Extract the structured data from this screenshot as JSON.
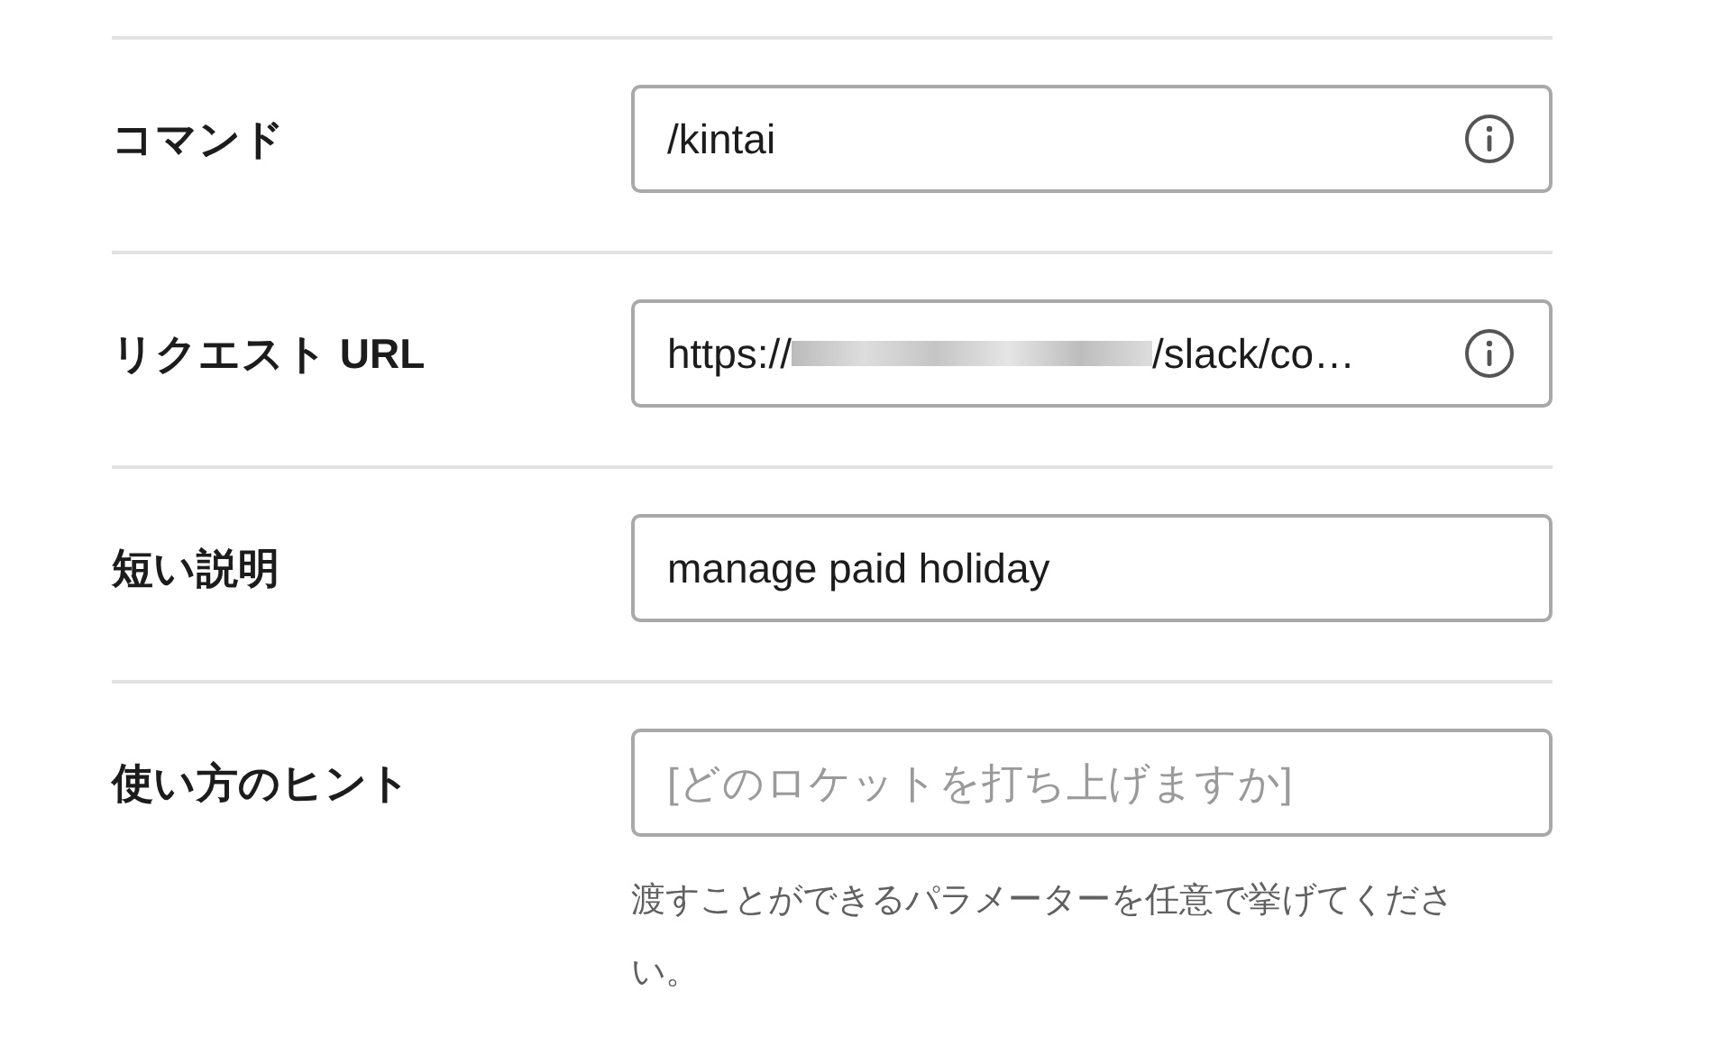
{
  "fields": [
    {
      "kind": "text",
      "label": "コマンド",
      "value": "/kintai",
      "info": true
    },
    {
      "kind": "redacted",
      "label": "リクエスト URL",
      "value": "https://",
      "value_end": "/slack/co…",
      "info": true
    },
    {
      "kind": "text",
      "label": "短い説明",
      "value": "manage paid holiday",
      "info": false
    },
    {
      "kind": "placeholder",
      "label": "使い方のヒント",
      "placeholder": "[どのロケットを打ち上げますか]",
      "info": false,
      "help": "渡すことができるパラメーターを任意で挙げてください。"
    }
  ]
}
